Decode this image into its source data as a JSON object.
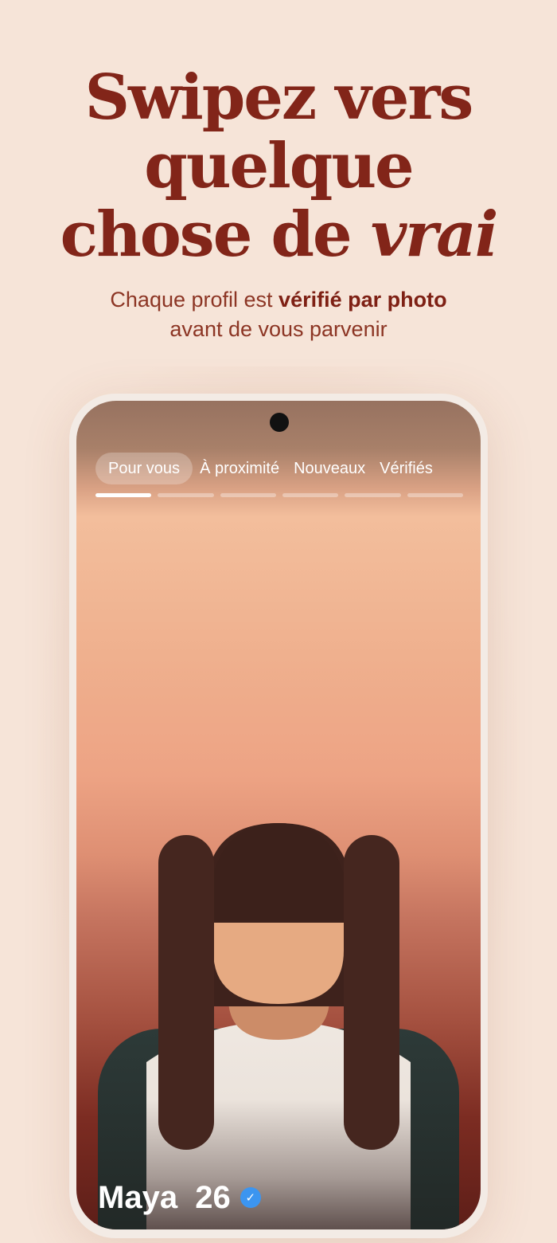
{
  "headline": {
    "line1": "Swipez vers",
    "line2": "quelque",
    "line3_prefix": "chose de ",
    "line3_emphasis": "vrai"
  },
  "subline": {
    "prefix": "Chaque profil est ",
    "bold": "vérifié par photo",
    "line2": "avant de vous parvenir"
  },
  "tabs": [
    {
      "label": "Pour vous",
      "active": true
    },
    {
      "label": "À proximité",
      "active": false
    },
    {
      "label": "Nouveaux",
      "active": false
    },
    {
      "label": "Vérifiés",
      "active": false
    }
  ],
  "photo_progress": {
    "total": 6,
    "current": 1
  },
  "profile": {
    "name": "Maya",
    "age": "26",
    "verified_icon": "verified-check-icon"
  },
  "colors": {
    "background": "#f6e4d8",
    "headline": "#822519",
    "verified_badge": "#3c95f0"
  }
}
